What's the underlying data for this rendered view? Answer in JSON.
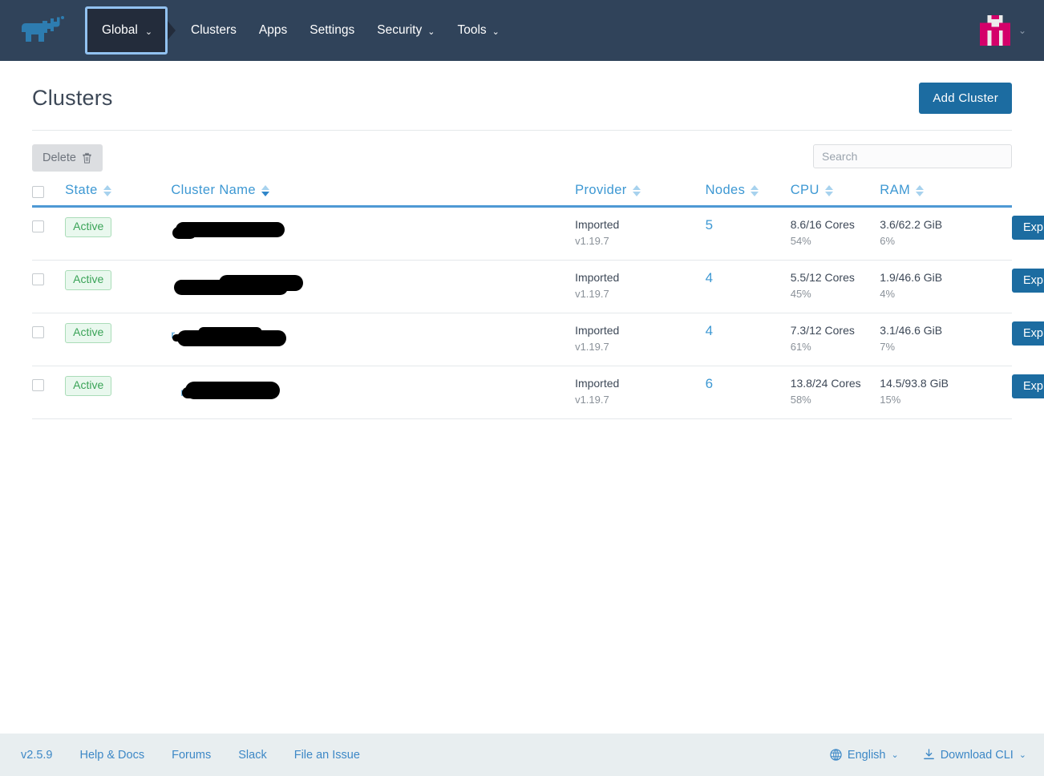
{
  "navbar": {
    "logo_name": "rancher-cow-logo",
    "context_selector": {
      "label": "Global",
      "caret": "⌄"
    },
    "links": [
      {
        "label": "Clusters",
        "has_caret": false
      },
      {
        "label": "Apps",
        "has_caret": false
      },
      {
        "label": "Settings",
        "has_caret": false
      },
      {
        "label": "Security",
        "has_caret": true
      },
      {
        "label": "Tools",
        "has_caret": true
      }
    ],
    "avatar_caret": "⌄",
    "avatar_color": "#d4006a"
  },
  "header": {
    "title": "Clusters",
    "add_cluster_label": "Add Cluster"
  },
  "toolbar": {
    "delete_label": "Delete",
    "delete_icon": "trash-icon",
    "search_placeholder": "Search",
    "search_value": ""
  },
  "table": {
    "columns": [
      {
        "key": "state",
        "label": "State",
        "sorted": false
      },
      {
        "key": "name",
        "label": "Cluster Name",
        "sorted": true
      },
      {
        "key": "provider",
        "label": "Provider",
        "sorted": false
      },
      {
        "key": "nodes",
        "label": "Nodes",
        "sorted": false
      },
      {
        "key": "cpu",
        "label": "CPU",
        "sorted": false
      },
      {
        "key": "ram",
        "label": "RAM",
        "sorted": false
      }
    ],
    "rows": [
      {
        "state": "Active",
        "name": "",
        "name_redacted": true,
        "provider": "Imported",
        "provider_version": "v1.19.7",
        "nodes": "5",
        "cpu": "8.6/16 Cores",
        "cpu_pct": "54%",
        "ram": "3.6/62.2 GiB",
        "ram_pct": "6%",
        "explorer_label": "Explorer",
        "peek_text": ""
      },
      {
        "state": "Active",
        "name": "",
        "name_redacted": true,
        "provider": "Imported",
        "provider_version": "v1.19.7",
        "nodes": "4",
        "cpu": "5.5/12 Cores",
        "cpu_pct": "45%",
        "ram": "1.9/46.6 GiB",
        "ram_pct": "4%",
        "explorer_label": "Explorer",
        "peek_text": ""
      },
      {
        "state": "Active",
        "name": "",
        "name_redacted": true,
        "provider": "Imported",
        "provider_version": "v1.19.7",
        "nodes": "4",
        "cpu": "7.3/12 Cores",
        "cpu_pct": "61%",
        "ram": "3.1/46.6 GiB",
        "ram_pct": "7%",
        "explorer_label": "Explorer",
        "peek_text": "r"
      },
      {
        "state": "Active",
        "name": "",
        "name_redacted": true,
        "provider": "Imported",
        "provider_version": "v1.19.7",
        "nodes": "6",
        "cpu": "13.8/24 Cores",
        "cpu_pct": "58%",
        "ram": "14.5/93.8 GiB",
        "ram_pct": "15%",
        "explorer_label": "Explorer",
        "peek_text": "r"
      }
    ]
  },
  "footer": {
    "version": "v2.5.9",
    "links": [
      {
        "label": "Help & Docs"
      },
      {
        "label": "Forums"
      },
      {
        "label": "Slack"
      },
      {
        "label": "File an Issue"
      }
    ],
    "language": {
      "label": "English",
      "icon": "globe-icon",
      "caret": "⌄"
    },
    "download_cli": {
      "label": "Download CLI",
      "icon": "download-icon",
      "caret": "⌄"
    }
  },
  "colors": {
    "nav_bg": "#30435a",
    "accent_blue": "#1c6ca1",
    "link_blue": "#3d98d3",
    "active_green": "#3aa357",
    "footer_bg": "#e8eef0"
  }
}
